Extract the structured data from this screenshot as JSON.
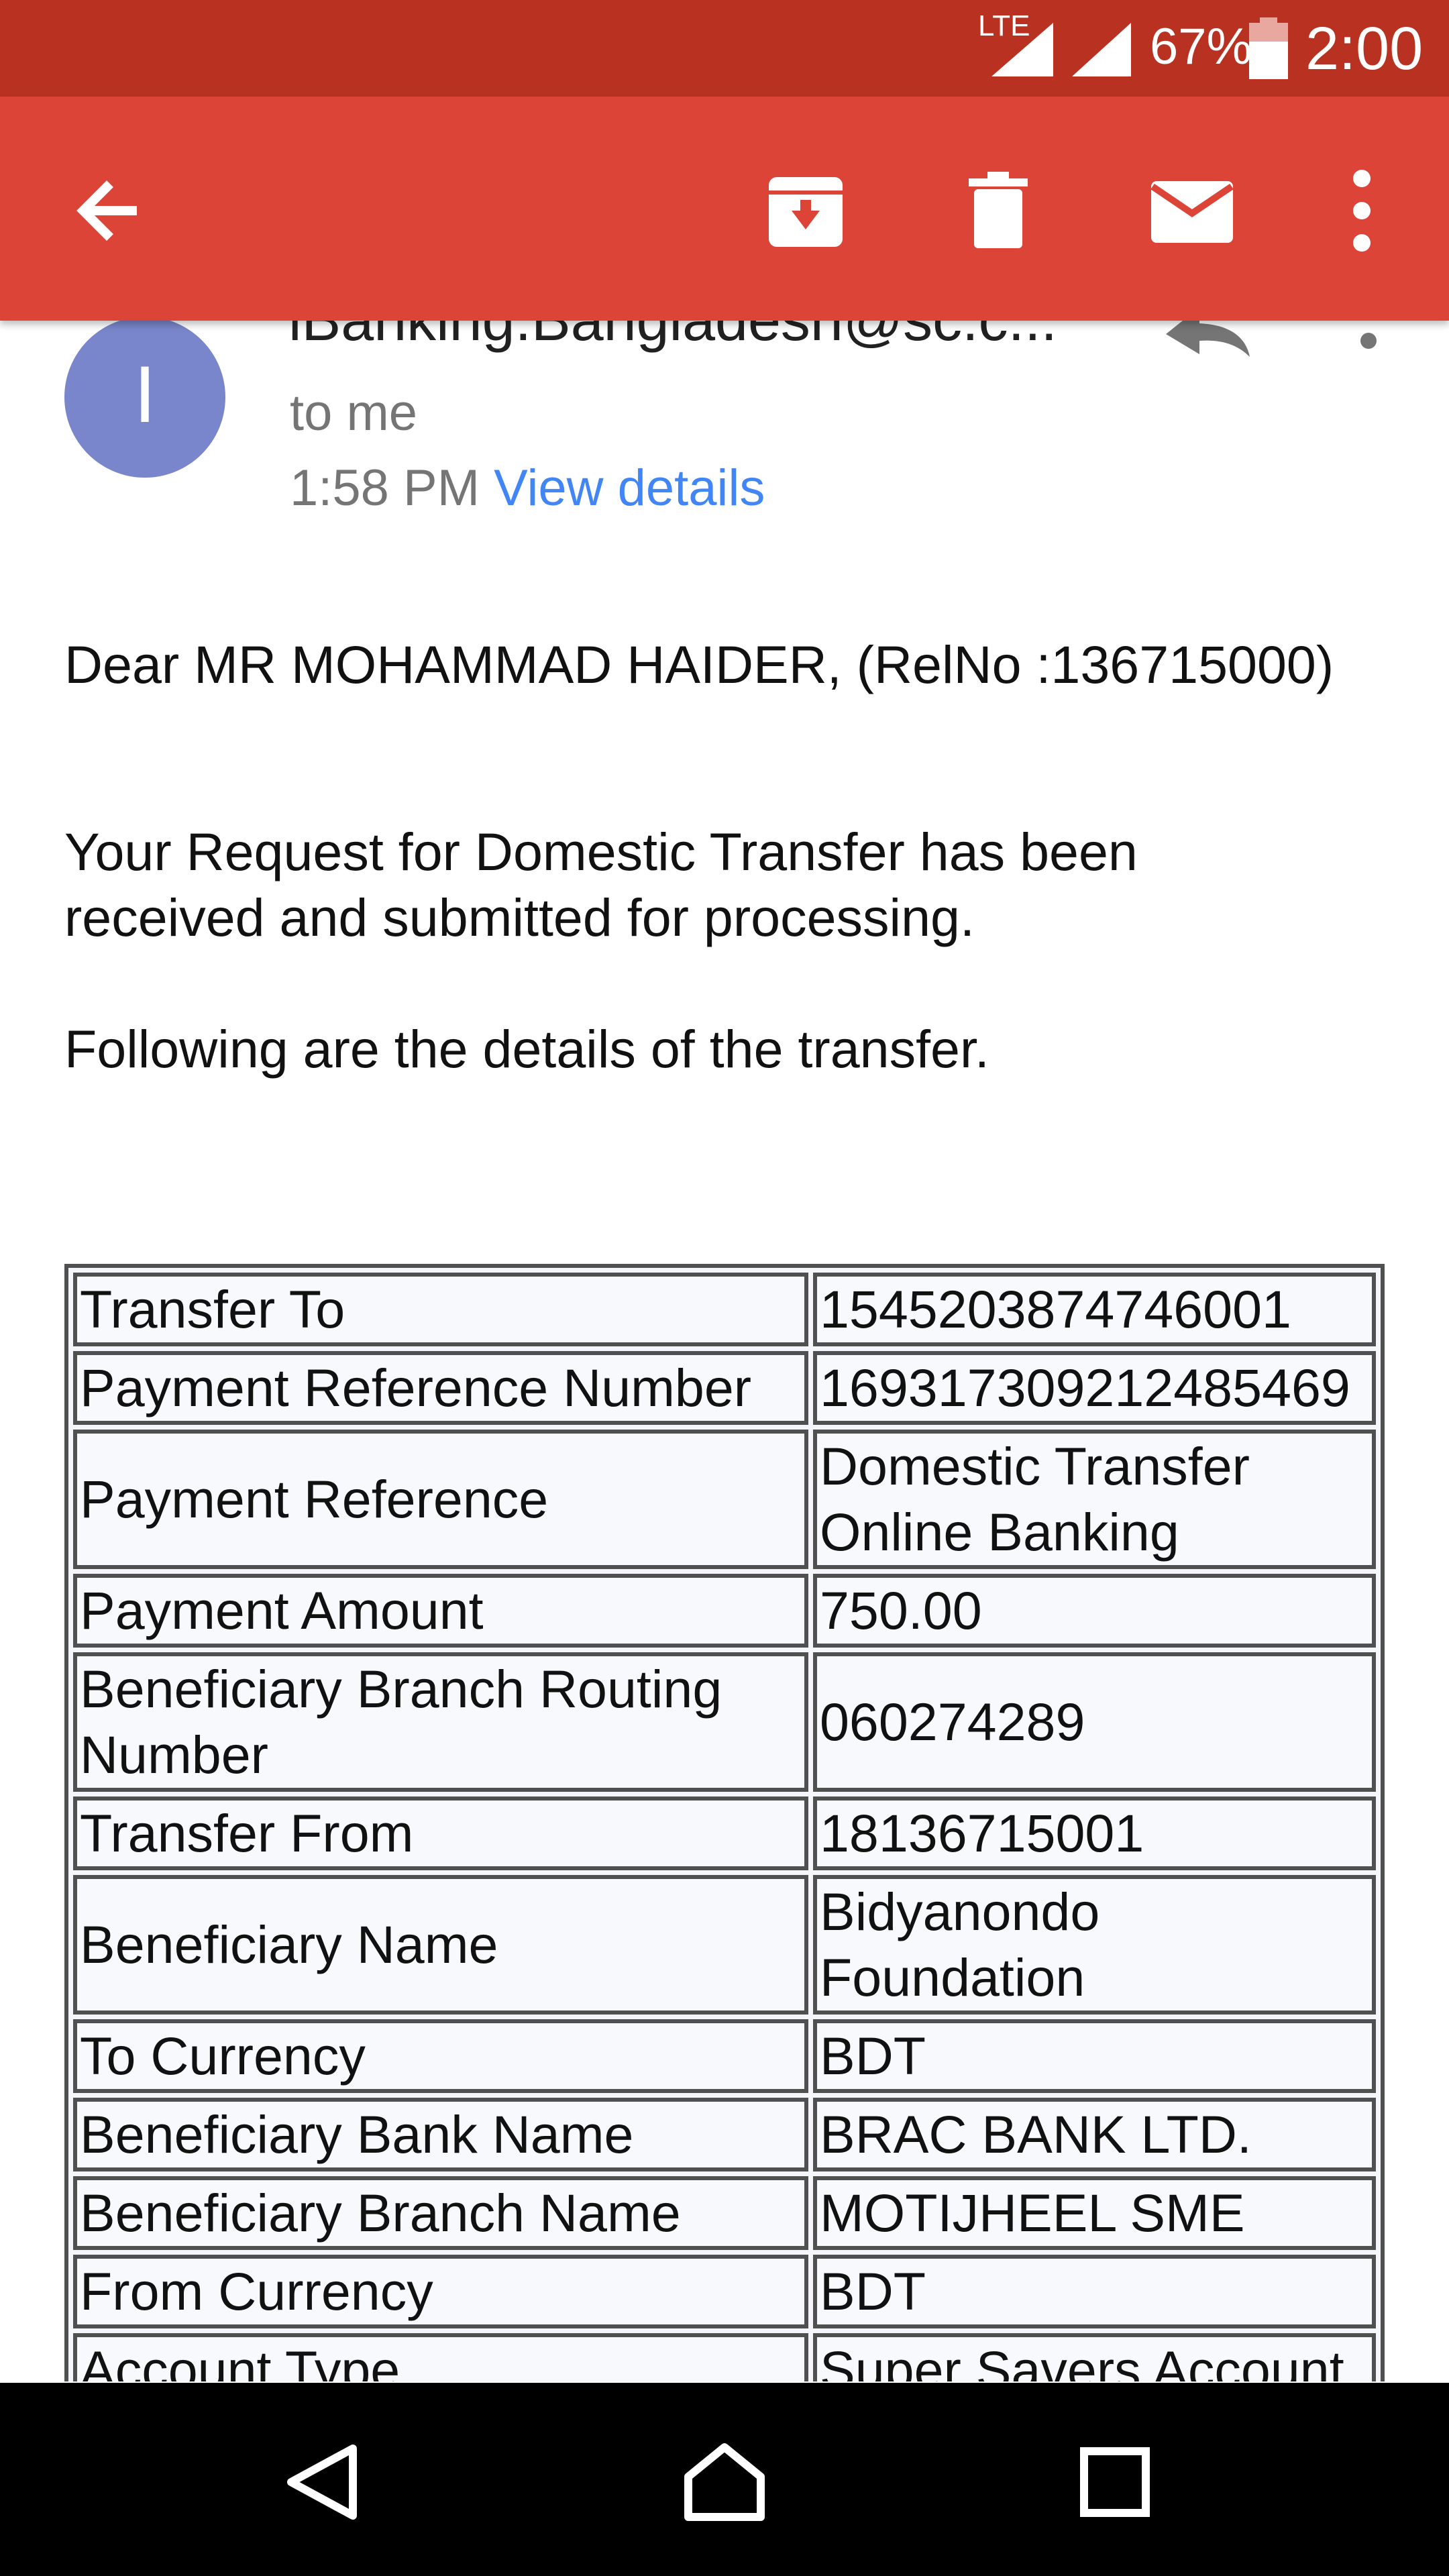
{
  "status_bar": {
    "network": "LTE",
    "battery": "67%",
    "battery_level": 0.67,
    "time": "2:00"
  },
  "app_bar": {
    "icons": [
      "back-arrow-icon",
      "archive-icon",
      "delete-icon",
      "mail-icon",
      "more-vert-icon"
    ]
  },
  "email": {
    "avatar_letter": "I",
    "sender": "iBanking.Bangladesh@sc.c...",
    "recipient": "to me",
    "time": "1:58 PM",
    "view_details": "View details",
    "greeting": "Dear MR MOHAMMAD HAIDER, (RelNo :136715000)",
    "body_line1": "Your Request for Domestic Transfer has been",
    "body_line2": "received and submitted for processing.",
    "body_line3": "Following are the details of the transfer."
  },
  "details": {
    "rows": [
      {
        "label": "Transfer To",
        "value": "1545203874746001"
      },
      {
        "label": "Payment Reference Number",
        "value": "169317309212485469"
      },
      {
        "label": "Payment Reference",
        "value": "Domestic Transfer Online Banking"
      },
      {
        "label": "Payment Amount",
        "value": "750.00"
      },
      {
        "label": "Beneficiary Branch Routing Number",
        "value": "060274289"
      },
      {
        "label": "Transfer From",
        "value": "18136715001"
      },
      {
        "label": "Beneficiary Name",
        "value": "Bidyanondo Foundation"
      },
      {
        "label": "To Currency",
        "value": "BDT"
      },
      {
        "label": "Beneficiary Bank Name",
        "value": "BRAC BANK LTD."
      },
      {
        "label": "Beneficiary Branch Name",
        "value": "MOTIJHEEL SME"
      },
      {
        "label": "From Currency",
        "value": "BDT"
      },
      {
        "label": "Account Type",
        "value": "Super Savers Account"
      }
    ]
  },
  "nav_bar": {
    "icons": [
      "back-nav-icon",
      "home-nav-icon",
      "recents-nav-icon"
    ]
  },
  "colors": {
    "status_bar": "#b93221",
    "app_bar": "#dc4437",
    "avatar": "#7986cb",
    "link": "#4285f4"
  }
}
